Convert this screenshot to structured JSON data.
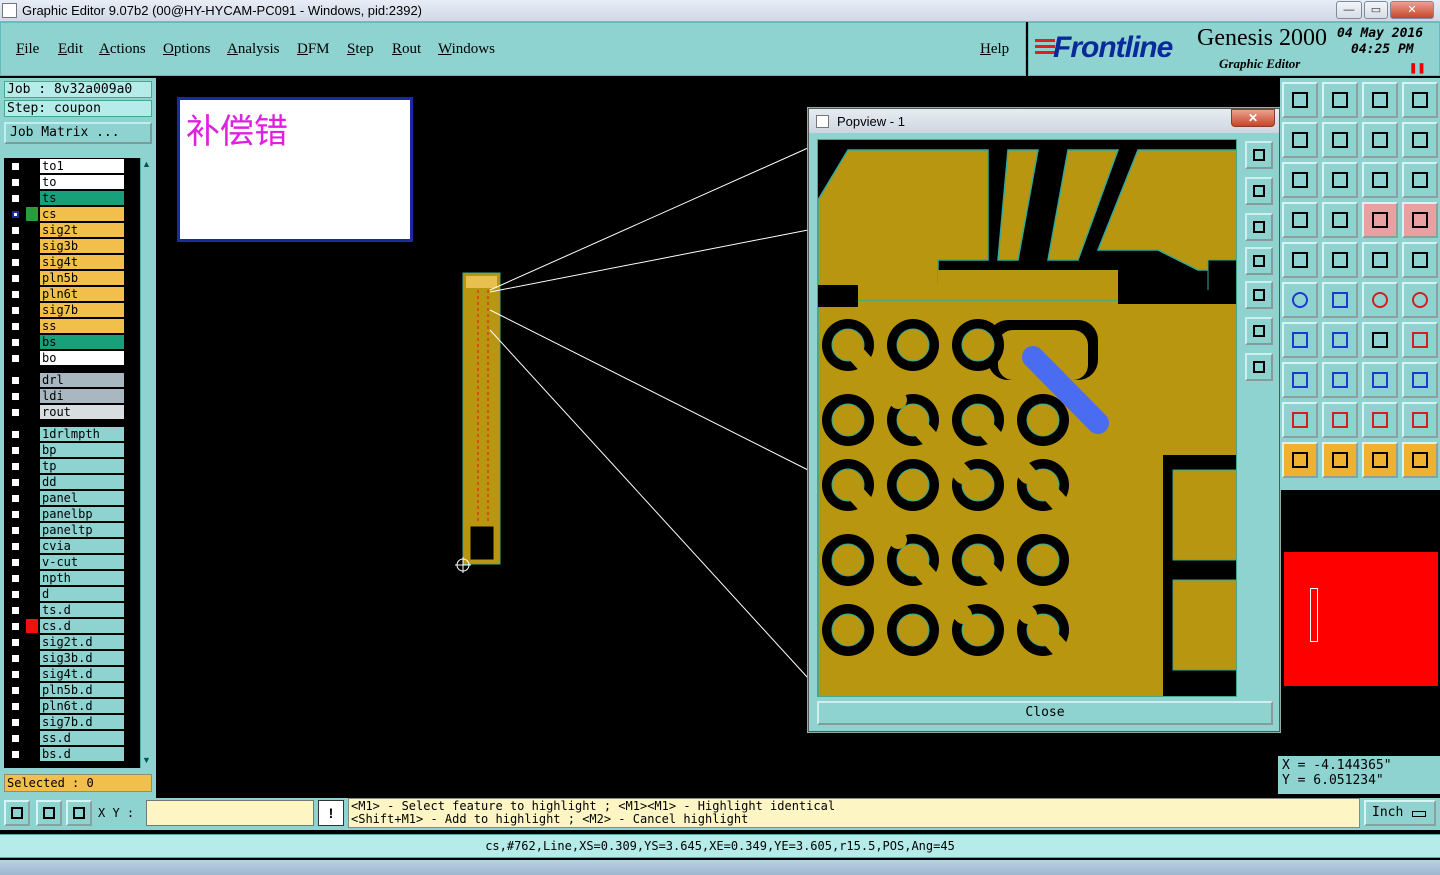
{
  "window": {
    "title": "Graphic Editor 9.07b2 (00@HY-HYCAM-PC091 - Windows, pid:2392)",
    "minimize": "—",
    "maximize": "▭",
    "close": "✕"
  },
  "menu": {
    "items": [
      "File",
      "Edit",
      "Actions",
      "Options",
      "Analysis",
      "DFM",
      "Step",
      "Rout",
      "Windows"
    ],
    "help": "Help"
  },
  "brand": {
    "logo": "Frontline",
    "product": "Genesis 2000",
    "subtitle": "Graphic Editor",
    "date": "04 May 2016",
    "time": "04:25 PM"
  },
  "job": {
    "job_label": "Job : 8v32a009a0",
    "step_label": "Step: coupon",
    "matrix_button": "Job Matrix ..."
  },
  "layers": [
    {
      "name": "to1",
      "color": "#ffffff",
      "mark": "",
      "selected": false
    },
    {
      "name": "to",
      "color": "#ffffff",
      "mark": "",
      "selected": false
    },
    {
      "name": "ts",
      "color": "#17a07a",
      "mark": "",
      "selected": false
    },
    {
      "name": "cs",
      "color": "#f2c04a",
      "mark": "#2a9a3a",
      "selected": true
    },
    {
      "name": "sig2t",
      "color": "#f2c04a",
      "mark": "",
      "selected": false
    },
    {
      "name": "sig3b",
      "color": "#f2c04a",
      "mark": "",
      "selected": false
    },
    {
      "name": "sig4t",
      "color": "#f2c04a",
      "mark": "",
      "selected": false
    },
    {
      "name": "pln5b",
      "color": "#f2c04a",
      "mark": "",
      "selected": false
    },
    {
      "name": "pln6t",
      "color": "#f2c04a",
      "mark": "",
      "selected": false
    },
    {
      "name": "sig7b",
      "color": "#f2c04a",
      "mark": "",
      "selected": false
    },
    {
      "name": "ss",
      "color": "#f2c04a",
      "mark": "",
      "selected": false
    },
    {
      "name": "bs",
      "color": "#17a07a",
      "mark": "",
      "selected": false
    },
    {
      "name": "bo",
      "color": "#ffffff",
      "mark": "",
      "selected": false
    },
    {
      "name": "drl",
      "color": "#a9b7c0",
      "mark": "",
      "selected": false
    },
    {
      "name": "ldi",
      "color": "#a9b7c0",
      "mark": "",
      "selected": false
    },
    {
      "name": "rout",
      "color": "#d8dde0",
      "mark": "",
      "selected": false
    },
    {
      "name": "1drlmpth",
      "color": "#8fd3d0",
      "mark": "",
      "selected": false
    },
    {
      "name": "bp",
      "color": "#8fd3d0",
      "mark": "",
      "selected": false
    },
    {
      "name": "tp",
      "color": "#8fd3d0",
      "mark": "",
      "selected": false
    },
    {
      "name": "dd",
      "color": "#8fd3d0",
      "mark": "",
      "selected": false
    },
    {
      "name": "panel",
      "color": "#8fd3d0",
      "mark": "",
      "selected": false
    },
    {
      "name": "panelbp",
      "color": "#8fd3d0",
      "mark": "",
      "selected": false
    },
    {
      "name": "paneltp",
      "color": "#8fd3d0",
      "mark": "",
      "selected": false
    },
    {
      "name": "cvia",
      "color": "#8fd3d0",
      "mark": "",
      "selected": false
    },
    {
      "name": "v-cut",
      "color": "#8fd3d0",
      "mark": "",
      "selected": false
    },
    {
      "name": "npth",
      "color": "#8fd3d0",
      "mark": "",
      "selected": false
    },
    {
      "name": "d",
      "color": "#8fd3d0",
      "mark": "",
      "selected": false
    },
    {
      "name": "ts.d",
      "color": "#8fd3d0",
      "mark": "",
      "selected": false
    },
    {
      "name": "cs.d",
      "color": "#8fd3d0",
      "mark": "#f01010",
      "selected": false
    },
    {
      "name": "sig2t.d",
      "color": "#8fd3d0",
      "mark": "",
      "selected": false
    },
    {
      "name": "sig3b.d",
      "color": "#8fd3d0",
      "mark": "",
      "selected": false
    },
    {
      "name": "sig4t.d",
      "color": "#8fd3d0",
      "mark": "",
      "selected": false
    },
    {
      "name": "pln5b.d",
      "color": "#8fd3d0",
      "mark": "",
      "selected": false
    },
    {
      "name": "pln6t.d",
      "color": "#8fd3d0",
      "mark": "",
      "selected": false
    },
    {
      "name": "sig7b.d",
      "color": "#8fd3d0",
      "mark": "",
      "selected": false
    },
    {
      "name": "ss.d",
      "color": "#8fd3d0",
      "mark": "",
      "selected": false
    },
    {
      "name": "bs.d",
      "color": "#8fd3d0",
      "mark": "",
      "selected": false
    }
  ],
  "selected_count": "Selected : 0",
  "canvas": {
    "note": "补偿错"
  },
  "popview": {
    "title": "Popview - 1",
    "close_button": "Close",
    "close_x": "✕"
  },
  "coords": {
    "x": "X = -4.144365\"",
    "y": "Y = 6.051234\""
  },
  "bottom": {
    "xy_label": "X Y :",
    "xy_value": "",
    "warn": "!",
    "help_line1": "<M1> - Select feature to highlight ; <M1><M1> - Highlight identical",
    "help_line2": "<Shift+M1> - Add to highlight ; <M2> - Cancel highlight",
    "unit": "Inch",
    "status": "cs,#762,Line,XS=0.309,YS=3.645,XE=0.349,YE=3.605,r15.5,POS,Ang=45"
  },
  "colors": {
    "panel": "#8fd3d0",
    "copper": "#b8960f",
    "highlight": "#4a6cf0",
    "canvas": "#000000"
  }
}
